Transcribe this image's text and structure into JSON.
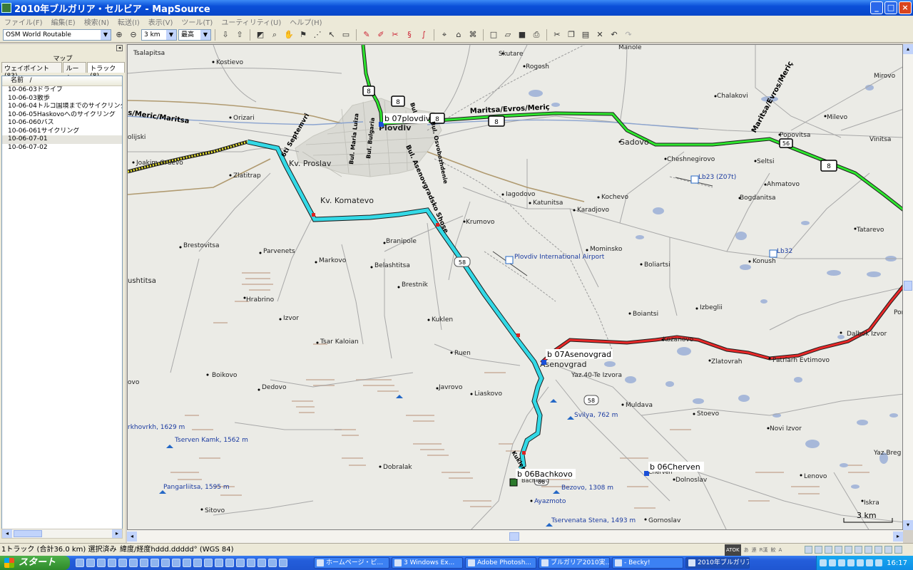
{
  "window": {
    "title": "2010年ブルガリア・セルビア - MapSource",
    "minimize": "_",
    "maximize": "□",
    "close": "×"
  },
  "menu": [
    "ファイル(F)",
    "編集(E)",
    "検索(N)",
    "転送(I)",
    "表示(V)",
    "ツール(T)",
    "ユーティリティ(U)",
    "ヘルプ(H)"
  ],
  "toolbar": {
    "map_product": "OSM World Routable",
    "zoom_scale": "3 km",
    "detail_level": "最高"
  },
  "sidebar": {
    "header": "マップ",
    "tabs": [
      "ウェイポイント (83)",
      "ルート",
      "トラック(8)"
    ],
    "active_tab": 2,
    "column_header": "名前",
    "sort_glyph": "/",
    "tracks": [
      "10-06-03ドライブ",
      "10-06-03散歩",
      "10-06-04トルコ国境までのサイクリング",
      "10-06-05Haskovoへのサイクリング",
      "10-06-060バス",
      "10-06-061サイクリング",
      "10-06-07-01",
      "10-06-07-02"
    ],
    "selected_index": 6
  },
  "map": {
    "colors": {
      "water": "#a7b8d9",
      "road": "#a8a8a8",
      "major_road": "#b09a70",
      "track_green": "#2ee62e",
      "track_cyan": "#33d9e6",
      "track_red": "#e82828",
      "track_yellow": "#e8e22e"
    },
    "labels": [
      {
        "t": "Tsalapitsa",
        "c": "#222"
      },
      {
        "t": "Kostievo",
        "c": "#222"
      },
      {
        "t": "Orizari",
        "c": "#222"
      },
      {
        "t": "Joakim Gruevo",
        "c": "#222"
      },
      {
        "t": "Zlatitrap",
        "c": "#222"
      },
      {
        "t": "Kv. Proslav",
        "c": "#222"
      },
      {
        "t": "Kv. Komatevo",
        "c": "#222"
      },
      {
        "t": "Brestovitsa",
        "c": "#222"
      },
      {
        "t": "Parvenets",
        "c": "#222"
      },
      {
        "t": "Markovo",
        "c": "#222"
      },
      {
        "t": "Belashtitsa",
        "c": "#222"
      },
      {
        "t": "Branipole",
        "c": "#222"
      },
      {
        "t": "Brestnik",
        "c": "#222"
      },
      {
        "t": "Hrabrino",
        "c": "#222"
      },
      {
        "t": "Izvor",
        "c": "#222"
      },
      {
        "t": "Kuklen",
        "c": "#222"
      },
      {
        "t": "Tsar Kaloian",
        "c": "#222"
      },
      {
        "t": "Ruen",
        "c": "#222"
      },
      {
        "t": "Boikovo",
        "c": "#222"
      },
      {
        "t": "Dedovo",
        "c": "#222"
      },
      {
        "t": "Javrovo",
        "c": "#222"
      },
      {
        "t": "Liaskovo",
        "c": "#222"
      },
      {
        "t": "Dobralak",
        "c": "#222"
      },
      {
        "t": "Sitovo",
        "c": "#222"
      },
      {
        "t": "Skutare",
        "c": "#222"
      },
      {
        "t": "Rogosh",
        "c": "#222"
      },
      {
        "t": "Manole",
        "c": "#222"
      },
      {
        "t": "Chalakovi",
        "c": "#222"
      },
      {
        "t": "Mirovo",
        "c": "#222"
      },
      {
        "t": "Milevo",
        "c": "#222"
      },
      {
        "t": "Popovitsa",
        "c": "#222"
      },
      {
        "t": "Vinitsa",
        "c": "#222"
      },
      {
        "t": "Sadovo",
        "c": "#222"
      },
      {
        "t": "Cheshnegirovo",
        "c": "#222"
      },
      {
        "t": "Seltsi",
        "c": "#222"
      },
      {
        "t": "Ahmatovo",
        "c": "#222"
      },
      {
        "t": "Bogdanitsa",
        "c": "#222"
      },
      {
        "t": "Iagodovo",
        "c": "#222"
      },
      {
        "t": "Katunitsa",
        "c": "#222"
      },
      {
        "t": "Kochevo",
        "c": "#222"
      },
      {
        "t": "Karadjovo",
        "c": "#222"
      },
      {
        "t": "Krumovo",
        "c": "#222"
      },
      {
        "t": "Tatarevo",
        "c": "#222"
      },
      {
        "t": "Mominsko",
        "c": "#222"
      },
      {
        "t": "Boliartsi",
        "c": "#222"
      },
      {
        "t": "Konush",
        "c": "#222"
      },
      {
        "t": "Izbeglii",
        "c": "#222"
      },
      {
        "t": "Boiantsi",
        "c": "#222"
      },
      {
        "t": "Poroin",
        "c": "#222"
      },
      {
        "t": "Dalbok Izvor",
        "c": "#222"
      },
      {
        "t": "Kozanovo",
        "c": "#222"
      },
      {
        "t": "Zlatovrah",
        "c": "#222"
      },
      {
        "t": "Patriarh Evtimovo",
        "c": "#222"
      },
      {
        "t": "Yaz.40-Te Izvora",
        "c": "#222"
      },
      {
        "t": "Muldava",
        "c": "#222"
      },
      {
        "t": "Stoevo",
        "c": "#222"
      },
      {
        "t": "Novi Izvor",
        "c": "#222"
      },
      {
        "t": "Yaz.Breg",
        "c": "#222"
      },
      {
        "t": "Lenovo",
        "c": "#222"
      },
      {
        "t": "Dolnoslav",
        "c": "#222"
      },
      {
        "t": "Iskra",
        "c": "#222"
      },
      {
        "t": "Gornoslav",
        "c": "#222"
      },
      {
        "t": "Ayazmoto",
        "c": "#1a3aa0"
      },
      {
        "t": "Plovdiv International Airport",
        "c": "#1a3aa0"
      },
      {
        "t": "Lb23 (Z07t)",
        "c": "#1a3aa0"
      },
      {
        "t": "Lb32",
        "c": "#1a3aa0"
      },
      {
        "t": "Svilya, 762 m",
        "c": "#1a3aa0"
      },
      {
        "t": "Bezovo, 1308 m",
        "c": "#1a3aa0"
      },
      {
        "t": "Tservenata Stena, 1493 m",
        "c": "#1a3aa0"
      },
      {
        "t": "Tserven Kamk, 1562 m",
        "c": "#1a3aa0"
      },
      {
        "t": "Pangarliitsa, 1595 m",
        "c": "#1a3aa0"
      },
      {
        "t": "rkhovrkh, 1629 m",
        "c": "#1a3aa0"
      },
      {
        "t": "olijski",
        "c": "#222"
      },
      {
        "t": "ushtitsa",
        "c": "#222"
      },
      {
        "t": "ovo",
        "c": "#222"
      },
      {
        "t": "Asenovgrad",
        "c": "#222"
      },
      {
        "t": "Plovdiv",
        "c": "#222"
      },
      {
        "t": "Bachkovo",
        "c": "#222"
      },
      {
        "t": "Cherven",
        "c": "#222"
      }
    ],
    "road_labels": [
      "Maritsa/Evros/Meriç",
      "Maritsa/Evros/Meriç",
      "s/Meric/Maritsa",
      "Bul. Asenovgradsko Shose",
      "6ti Septemvri",
      "Bul. Maria Luiza",
      "Bul. Bulgaria",
      "Bul. Osvobozhdenie",
      "Bul. C",
      "Kukleno"
    ],
    "shields": [
      "8",
      "8",
      "8",
      "8",
      "56",
      "8",
      "58",
      "58",
      "86"
    ],
    "waypoints": [
      {
        "name": "b 07plovdiv"
      },
      {
        "name": "b 07Asenovgrad"
      },
      {
        "name": "b 06Bachkovo"
      },
      {
        "name": "b 06Cherven"
      }
    ],
    "scale_label": "3 km"
  },
  "status": {
    "selection": "1トラック (合計36.0 km) 選択済み",
    "coords": "緯度/経度hddd.ddddd°  (WGS 84)",
    "ime_box": "ATOK",
    "ime_modes": [
      "あ",
      "連",
      "R漢",
      "鮫",
      "A"
    ]
  },
  "taskbar": {
    "start": "スタート",
    "tasks": [
      "ホームページ・ビ...",
      "3 Windows Ex...",
      "Adobe Photosh...",
      "ブルガリア2010実...",
      "- Becky!",
      "2010年ブルガリア..."
    ],
    "active_task": 5,
    "clock": "16:17"
  }
}
